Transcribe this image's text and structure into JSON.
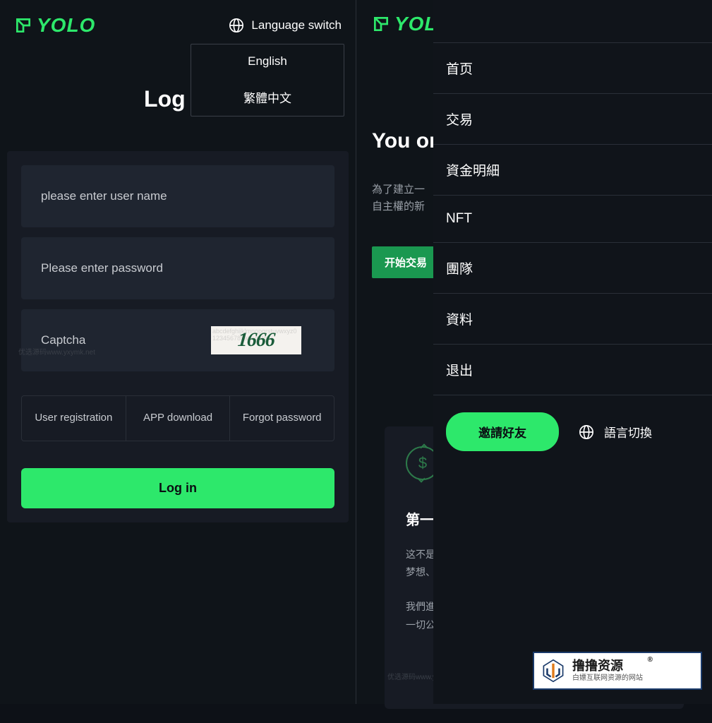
{
  "brand": "YOLO",
  "left": {
    "lang_switch": "Language switch",
    "lang_options": [
      "English",
      "繁體中文"
    ],
    "title": "Log in",
    "username_ph": "please enter user name",
    "password_ph": "Please enter password",
    "captcha_ph": "Captcha",
    "captcha_code": "1666",
    "links": {
      "register": "User registration",
      "download": "APP download",
      "forgot": "Forgot password"
    },
    "login_btn": "Log in",
    "watermark": "优选源码www.yxymk.net"
  },
  "right": {
    "hero_title": "You or",
    "hero_desc_line1": "為了建立一",
    "hero_desc_line2": "自主權的新",
    "start_btn": "开始交易",
    "card": {
      "title": "第一個",
      "para1": "这不是最坏的时代，也不是最好的时代。一直以来最不拒绝梦想、欢迎挑战、拥抱变革的时代。",
      "para2": "我們進入了一個充满意义。世界正充満変革的时代。如果说一切公正的人类的序幕中，那一代与后人..."
    },
    "drawer": {
      "items": [
        "首页",
        "交易",
        "資金明細",
        "NFT",
        "團隊",
        "資料",
        "退出"
      ],
      "invite": "邀請好友",
      "lang_switch": "語言切換"
    },
    "watermark": "优选源码www.yxymk.net"
  },
  "badge": {
    "main": "撸撸资源",
    "sub": "白嫖互联网资源的网站",
    "reg": "®"
  }
}
